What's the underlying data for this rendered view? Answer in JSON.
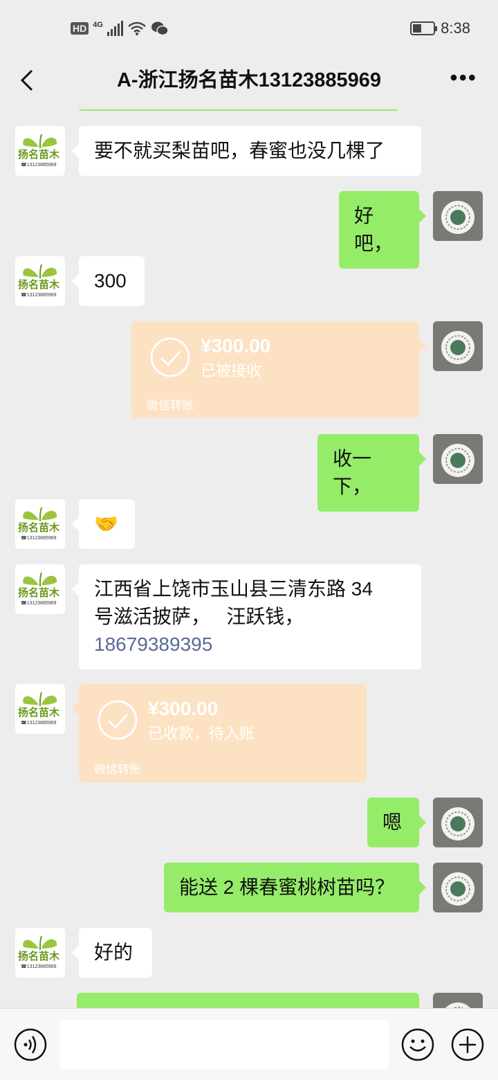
{
  "status_bar": {
    "hd": "HD",
    "network": "4G",
    "time": "8:38"
  },
  "header": {
    "title": "A-浙江扬名苗木13123885969",
    "back_icon": "chevron-left-icon",
    "more_icon": "more-dots-icon"
  },
  "shop_avatar": {
    "name": "扬名苗木",
    "phone": "☎13123885969"
  },
  "messages": [
    {
      "from": "them",
      "type": "text",
      "text": "要不就买梨苗吧，春蜜也没几棵了"
    },
    {
      "from": "me",
      "type": "text",
      "text": "好吧，"
    },
    {
      "from": "them",
      "type": "text",
      "text": "300"
    },
    {
      "from": "me",
      "type": "transfer",
      "amount": "¥300.00",
      "status": "已被接收",
      "footer": "微信转账"
    },
    {
      "from": "me",
      "type": "text",
      "text": "收一下，"
    },
    {
      "from": "them",
      "type": "emoji",
      "emoji": "🤝"
    },
    {
      "from": "them",
      "type": "text",
      "line1": "江西省上饶市玉山县三清东路 34",
      "line2": "号滋活披萨，   汪跃钱，",
      "phone": "18679389395"
    },
    {
      "from": "them",
      "type": "transfer",
      "amount": "¥300.00",
      "status": "已收款，待入账",
      "footer": "微信转账"
    },
    {
      "from": "me",
      "type": "text",
      "text": "嗯"
    },
    {
      "from": "me",
      "type": "text",
      "text": "能送 2 棵春蜜桃树苗吗？"
    },
    {
      "from": "them",
      "type": "text",
      "text": "好的"
    }
  ],
  "colors": {
    "bg": "#ededed",
    "my_bubble": "#95ec69",
    "their_bubble": "#ffffff",
    "transfer": "#fde1c3",
    "link": "#576b95"
  },
  "input_bar": {
    "voice_icon": "voice-icon",
    "emoji_icon": "emoji-icon",
    "plus_icon": "plus-icon"
  }
}
